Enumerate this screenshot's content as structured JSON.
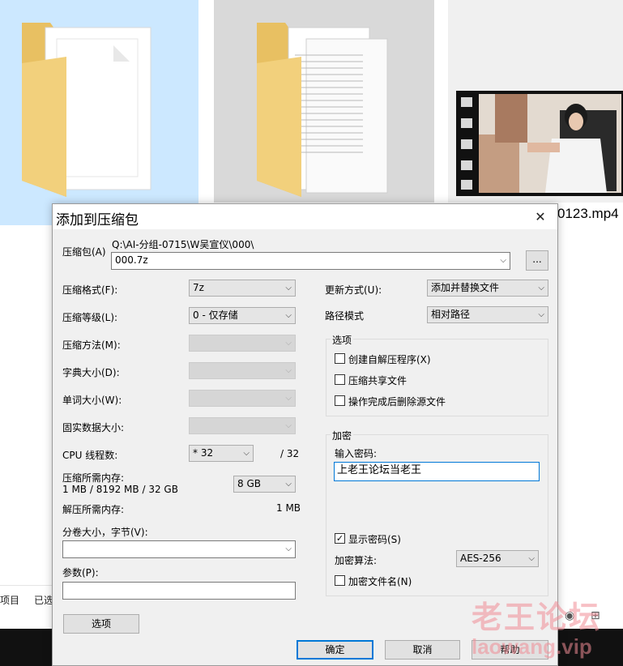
{
  "background": {
    "file_name_visible": "0123.mp4",
    "status_items": "项目",
    "status_selected": "已选",
    "watermark_cn": "老王论坛",
    "watermark_en": "laowang.vip"
  },
  "dialog": {
    "title": "添加到压缩包",
    "close_icon": "close-icon",
    "archive": {
      "label": "压缩包(A)",
      "path": "Q:\\AI-分组-0715\\W吴宣仪\\000\\",
      "filename": "000.7z",
      "browse_label": "..."
    },
    "left": {
      "format_label": "压缩格式(F):",
      "format_value": "7z",
      "level_label": "压缩等级(L):",
      "level_value": "0 - 仅存储",
      "method_label": "压缩方法(M):",
      "dict_label": "字典大小(D):",
      "word_label": "单词大小(W):",
      "solid_label": "固实数据大小:",
      "threads_label": "CPU 线程数:",
      "threads_value": "* 32",
      "threads_max": "/ 32",
      "mem_compress_label": "压缩所需内存:",
      "mem_compress_detail": "1 MB / 8192 MB / 32 GB",
      "mem_compress_value": "8 GB",
      "mem_decompress_label": "解压所需内存:",
      "mem_decompress_value": "1 MB",
      "volume_label": "分卷大小，字节(V):",
      "params_label": "参数(P):",
      "options_button": "选项"
    },
    "right": {
      "update_label": "更新方式(U):",
      "update_value": "添加并替换文件",
      "path_mode_label": "路径模式",
      "path_mode_value": "相对路径",
      "options_group": "选项",
      "opt_sfx": "创建自解压程序(X)",
      "opt_shared": "压缩共享文件",
      "opt_delete": "操作完成后删除源文件",
      "encrypt_group": "加密",
      "password_label": "输入密码:",
      "password_value": "上老王论坛当老王",
      "show_password": "显示密码(S)",
      "show_password_checked": true,
      "method_label": "加密算法:",
      "method_value": "AES-256",
      "encrypt_names": "加密文件名(N)"
    },
    "buttons": {
      "ok": "确定",
      "cancel": "取消",
      "help": "帮助"
    }
  }
}
